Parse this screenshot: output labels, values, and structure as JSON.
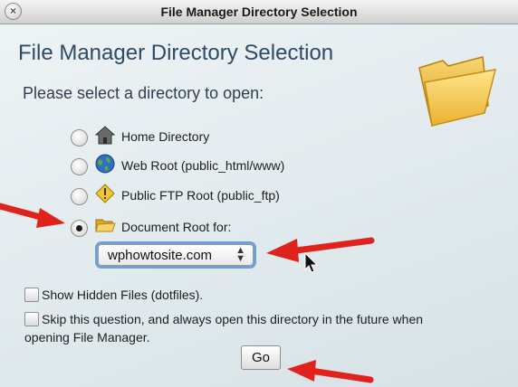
{
  "window": {
    "title": "File Manager Directory Selection",
    "close_icon": "close-icon"
  },
  "dialog": {
    "heading": "File Manager Directory Selection",
    "prompt": "Please select a directory to open:",
    "options": [
      {
        "label": "Home Directory",
        "icon": "house-icon",
        "selected": false
      },
      {
        "label": "Web Root (public_html/www)",
        "icon": "globe-icon",
        "selected": false
      },
      {
        "label": "Public FTP Root (public_ftp)",
        "icon": "ftp-warning-icon",
        "selected": false
      },
      {
        "label": "Document Root for:",
        "icon": "folder-icon",
        "selected": true
      }
    ],
    "domain_select": {
      "value": "wphowtosite.com"
    },
    "show_hidden": {
      "label": "Show Hidden Files (dotfiles).",
      "checked": false
    },
    "skip_question": {
      "line1": "Skip this question, and always open this directory in the future when",
      "line2": "opening File Manager.",
      "checked": false
    },
    "go_label": "Go"
  },
  "annotation_color": "#e0221c"
}
